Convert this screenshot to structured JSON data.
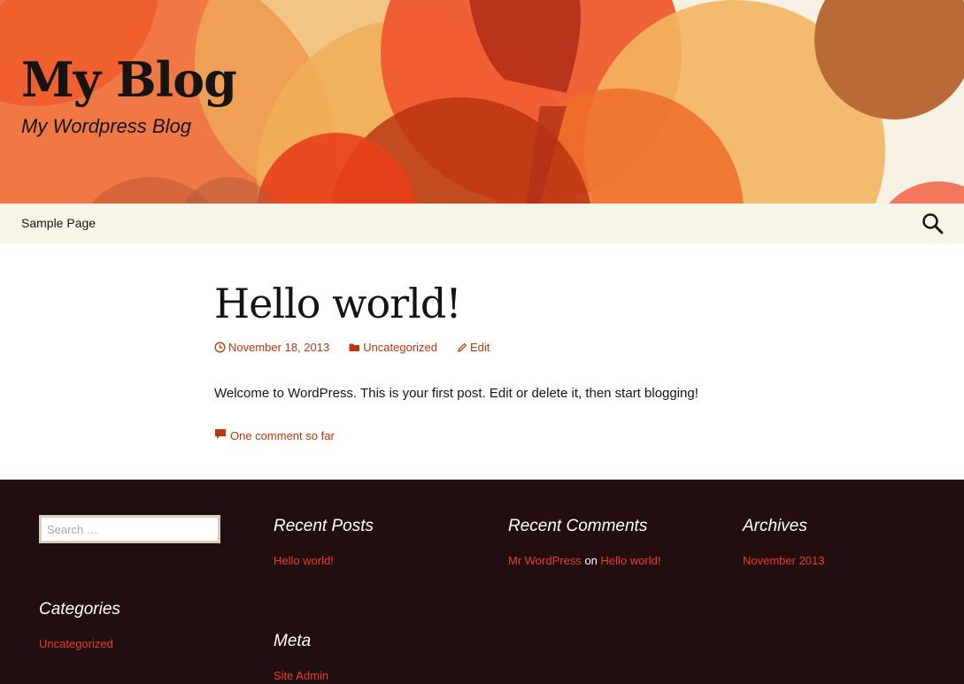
{
  "header": {
    "site_title": "My Blog",
    "site_description": "My Wordpress Blog"
  },
  "nav": {
    "items": [
      {
        "label": "Sample Page"
      }
    ],
    "search_icon": "search-icon"
  },
  "post": {
    "title": "Hello world!",
    "date": "November 18, 2013",
    "category": "Uncategorized",
    "edit_label": "Edit",
    "content": "Welcome to WordPress. This is your first post. Edit or delete it, then start blogging!",
    "comments_label": "One comment so far"
  },
  "footer": {
    "search_placeholder": "Search …",
    "recent_posts": {
      "title": "Recent Posts",
      "items": [
        "Hello world!"
      ]
    },
    "recent_comments": {
      "title": "Recent Comments",
      "items": [
        {
          "author": "Mr WordPress",
          "connector": "on",
          "post": "Hello world!"
        }
      ]
    },
    "archives": {
      "title": "Archives",
      "items": [
        "November 2013"
      ]
    },
    "categories": {
      "title": "Categories",
      "items": [
        "Uncategorized"
      ]
    },
    "meta": {
      "title": "Meta",
      "items": [
        "Site Admin"
      ]
    }
  },
  "colors": {
    "link": "#bc360a",
    "footer_link": "#e63f2a",
    "footer_bg": "#220e10",
    "nav_bg": "#f7f5e7"
  }
}
